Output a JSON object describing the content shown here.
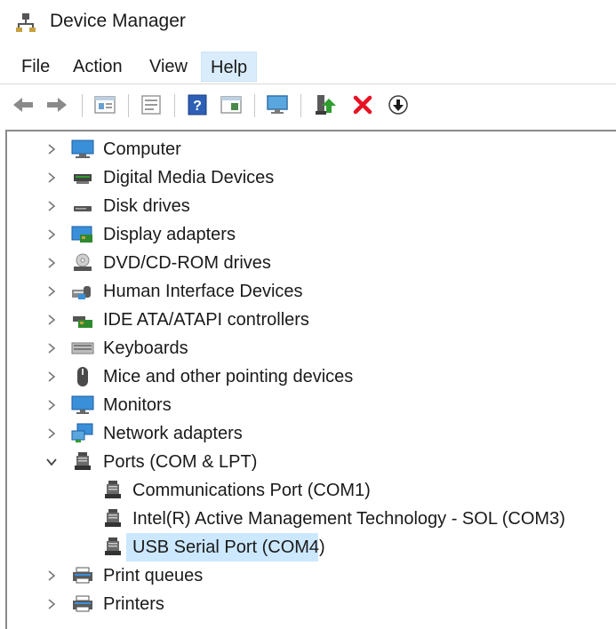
{
  "window": {
    "title": "Device Manager"
  },
  "menu": {
    "file": "File",
    "action": "Action",
    "view": "View",
    "help": "Help"
  },
  "tree": {
    "computer": "Computer",
    "digital_media": "Digital Media Devices",
    "disk": "Disk drives",
    "display": "Display adapters",
    "dvd": "DVD/CD-ROM drives",
    "hid": "Human Interface Devices",
    "ide": "IDE ATA/ATAPI controllers",
    "keyboards": "Keyboards",
    "mice": "Mice and other pointing devices",
    "monitors": "Monitors",
    "network": "Network adapters",
    "ports": "Ports (COM & LPT)",
    "port_com1": "Communications Port (COM1)",
    "port_com3": "Intel(R) Active Management Technology - SOL (COM3)",
    "port_com4": "USB Serial Port (COM4)",
    "print_queues": "Print queues",
    "printers": "Printers"
  },
  "colors": {
    "selection": "#cce8ff",
    "menu_active": "#d9ecfb",
    "error_red": "#e81123",
    "action_green": "#2e9e2e"
  }
}
